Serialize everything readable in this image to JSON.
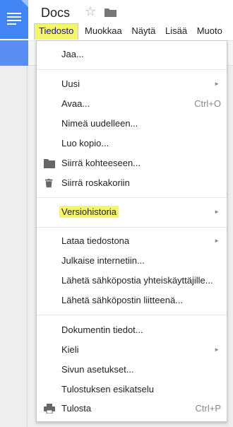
{
  "app": {
    "title": "Docs",
    "star_icon": "star-icon",
    "folder_icon": "folder-icon"
  },
  "menubar": {
    "items": [
      "Tiedosto",
      "Muokkaa",
      "Näytä",
      "Lisää",
      "Muoto"
    ],
    "active": "Tiedosto",
    "highlight_color": "#f4f56a"
  },
  "file_menu": {
    "share": "Jaa...",
    "new": "Uusi",
    "open": "Avaa...",
    "open_shortcut": "Ctrl+O",
    "rename": "Nimeä uudelleen...",
    "make_copy": "Luo kopio...",
    "move_to": "Siirrä kohteeseen...",
    "move_to_trash": "Siirrä roskakoriin",
    "version_history": "Versiohistoria",
    "download_as": "Lataa tiedostona",
    "publish": "Julkaise internetiin...",
    "email_collaborators": "Lähetä sähköpostia yhteiskäyttäjille...",
    "email_attachment": "Lähetä sähköpostin liitteenä...",
    "doc_details": "Dokumentin tiedot...",
    "language": "Kieli",
    "page_setup": "Sivun asetukset...",
    "print_preview": "Tulostuksen esikatselu",
    "print": "Tulosta",
    "print_shortcut": "Ctrl+P",
    "submenu_arrow": "►"
  },
  "colors": {
    "brand_blue": "#4285f4",
    "highlight_yellow": "#f4f56a"
  }
}
